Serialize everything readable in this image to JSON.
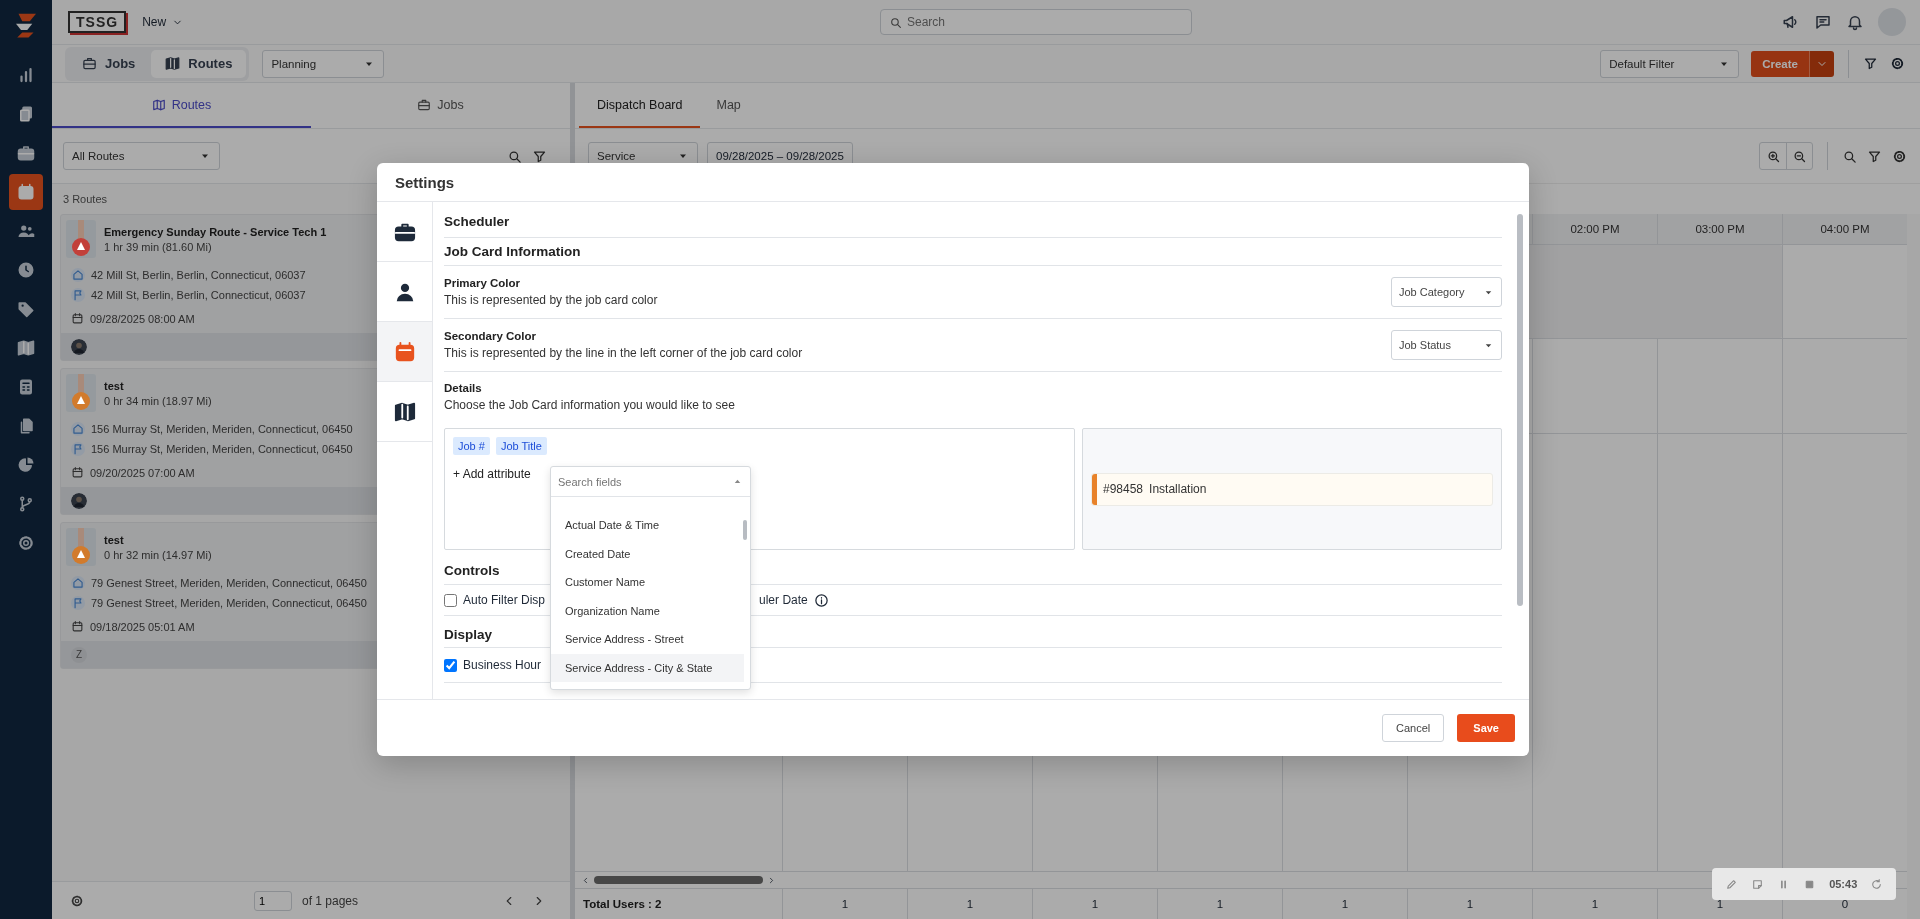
{
  "top_bar": {
    "logo_text": "TSSG",
    "new_menu": "New",
    "search": {
      "placeholder": "Search"
    }
  },
  "sidebar": {
    "items": [
      {
        "selected": false
      },
      {
        "selected": false
      },
      {
        "selected": false
      },
      {
        "selected": true
      },
      {
        "selected": false
      },
      {
        "selected": false
      },
      {
        "selected": false
      },
      {
        "selected": false
      },
      {
        "selected": false
      },
      {
        "selected": false
      },
      {
        "selected": false
      },
      {
        "selected": false
      },
      {
        "selected": false
      }
    ]
  },
  "toolbar": {
    "view_toggle": [
      {
        "label": "Jobs",
        "selected": false
      },
      {
        "label": "Routes",
        "selected": true
      }
    ],
    "planning_select": "Planning",
    "filter_select": "Default Filter",
    "create_button": "Create"
  },
  "left_panel": {
    "tabs": [
      {
        "label": "Routes",
        "selected": true
      },
      {
        "label": "Jobs",
        "selected": false
      }
    ],
    "route_filter": "All Routes",
    "count": "3 Routes",
    "routes": [
      {
        "name": "Emergency Sunday Route - Service Tech 1",
        "duration": "1 hr 39 min (81.60 Mi)",
        "color": "#c2403a",
        "start": "42 Mill St, Berlin, Berlin, Connecticut, 06037",
        "end": "42 Mill St, Berlin, Berlin, Connecticut, 06037",
        "date": "09/28/2025 08:00 AM",
        "avatar": {
          "kind": "photo"
        }
      },
      {
        "name": "test",
        "duration": "0 hr 34 min (18.97 Mi)",
        "color": "#d27b2c",
        "start": "156 Murray St, Meriden, Meriden, Connecticut, 06450",
        "end": "156 Murray St, Meriden, Meriden, Connecticut, 06450",
        "date": "09/20/2025 07:00 AM",
        "avatar": {
          "kind": "photo"
        }
      },
      {
        "name": "test",
        "duration": "0 hr 32 min (14.97 Mi)",
        "color": "#d27b2c",
        "start": "79 Genest Street, Meriden, Meriden, Connecticut, 06450",
        "end": "79 Genest Street, Meriden, Meriden, Connecticut, 06450",
        "date": "09/18/2025 05:01 AM",
        "avatar": {
          "kind": "initial",
          "text": "Z"
        }
      }
    ],
    "pagination": {
      "page": "1",
      "total": "of 1 pages"
    }
  },
  "board": {
    "tabs": [
      {
        "label": "Dispatch Board",
        "selected": true
      },
      {
        "label": "Map",
        "selected": false
      }
    ],
    "service_select": "Service",
    "date_range": "09/28/2025 – 09/28/2025",
    "time_headers": [
      "02:00 PM",
      "03:00 PM",
      "04:00 PM"
    ],
    "total_users": "Total Users : 2",
    "column_totals": [
      "1",
      "1",
      "1",
      "1",
      "1",
      "1",
      "1",
      "1",
      "0"
    ]
  },
  "settings_modal": {
    "title": "Settings",
    "nav": [
      {
        "selected": false
      },
      {
        "selected": false
      },
      {
        "selected": true
      },
      {
        "selected": false
      }
    ],
    "scheduler_heading": "Scheduler",
    "job_card_heading": "Job Card Information",
    "color_settings": [
      {
        "label": "Primary Color",
        "description": "This is represented by the job card color",
        "value": "Job Category"
      },
      {
        "label": "Secondary Color",
        "description": "This is represented by the line in the left corner of the job card color",
        "value": "Job Status"
      }
    ],
    "details": {
      "label": "Details",
      "description": "Choose the Job Card information you would like to see",
      "attributes": [
        "Job #",
        "Job Title"
      ],
      "add_attribute": "+ Add attribute",
      "field_search": {
        "placeholder": "Search fields",
        "options": [
          {
            "label": "Actual Date & Time",
            "selected": false
          },
          {
            "label": "Created Date",
            "selected": false
          },
          {
            "label": "Customer Name",
            "selected": false
          },
          {
            "label": "Organization Name",
            "selected": false
          },
          {
            "label": "Service Address - Street",
            "selected": false
          },
          {
            "label": "Service Address - City & State",
            "selected": true
          }
        ]
      },
      "preview": {
        "number": "#98458",
        "title": "Installation",
        "color": "#e8822a"
      }
    },
    "controls_heading": "Controls",
    "control": {
      "checked": false,
      "label_start": "Auto Filter Disp",
      "label_end": "uler Date"
    },
    "display_heading": "Display",
    "display_option": {
      "checked": true,
      "label": "Business Hour"
    },
    "buttons": {
      "cancel": "Cancel",
      "save": "Save"
    }
  },
  "recorder": {
    "time": "05:43"
  }
}
